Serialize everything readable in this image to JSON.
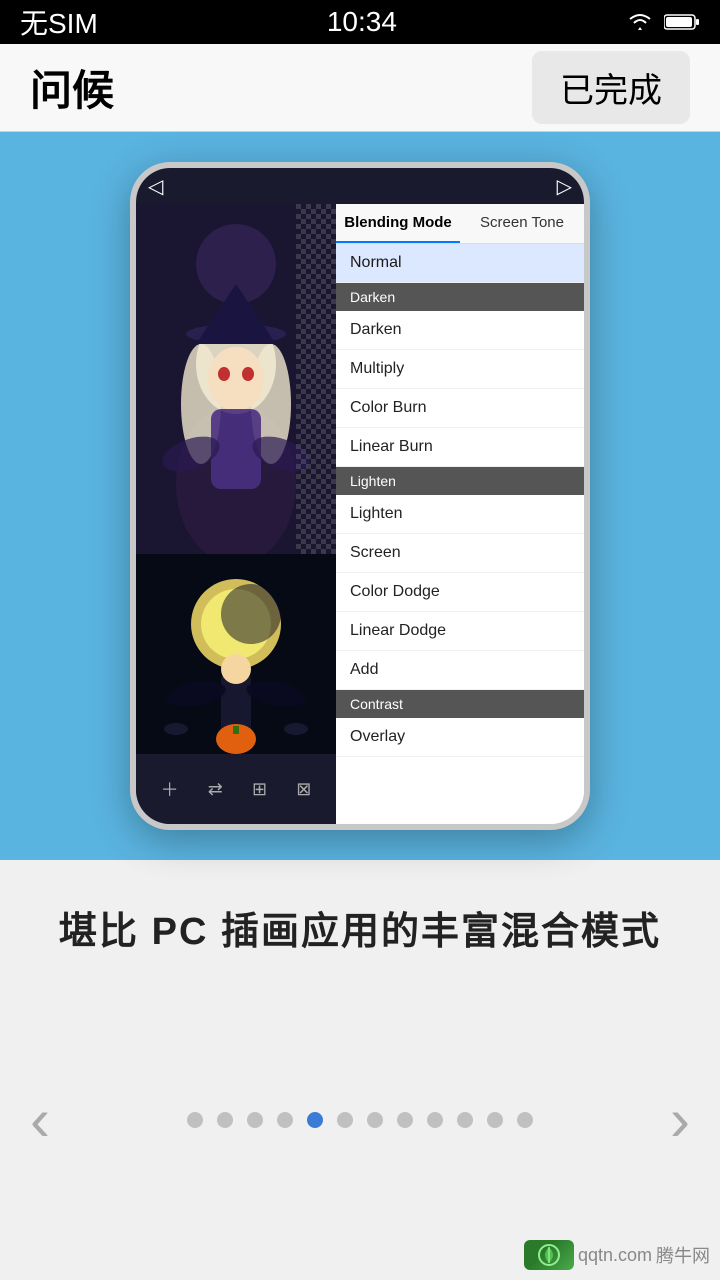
{
  "status_bar": {
    "carrier": "无SIM",
    "time": "10:34",
    "wifi_icon": "wifi-icon",
    "battery_icon": "battery-icon"
  },
  "nav_bar": {
    "title": "问候",
    "done_label": "已完成"
  },
  "carousel": {
    "bg_color": "#5ab4e0"
  },
  "phone": {
    "top_bar": {
      "back_symbol": "◁",
      "forward_symbol": "▷"
    },
    "blend_tabs": [
      {
        "label": "Blending Mode",
        "active": true
      },
      {
        "label": "Screen Tone",
        "active": false
      }
    ],
    "blend_categories": [
      {
        "name": "Darken",
        "items": [
          "Darken",
          "Multiply",
          "Color Burn",
          "Linear Burn"
        ]
      },
      {
        "name": "Lighten",
        "items": [
          "Lighten",
          "Screen",
          "Color Dodge",
          "Linear Dodge",
          "Add"
        ]
      },
      {
        "name": "Contrast",
        "items": [
          "Overlay"
        ]
      }
    ],
    "normal_item": "Normal"
  },
  "caption": {
    "text": "堪比 PC 插画应用的丰富混合模式"
  },
  "dots": {
    "count": 12,
    "active_index": 4
  },
  "arrows": {
    "left": "‹",
    "right": "›"
  },
  "watermark": {
    "site": "qqtn.com",
    "brand": "腾牛网"
  }
}
